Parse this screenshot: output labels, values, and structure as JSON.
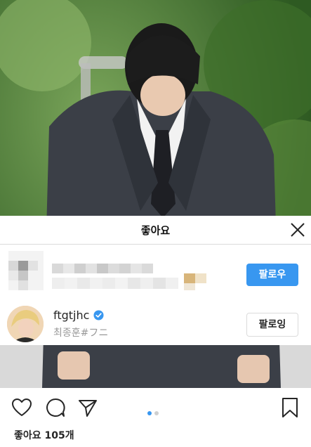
{
  "sheet": {
    "title": "좋아요",
    "rows": [
      {
        "follow_label": "팔로우"
      },
      {
        "username": "ftgtjhc",
        "subtitle": "최종훈#フニ",
        "follow_label": "팔로잉"
      }
    ]
  },
  "post": {
    "likes_text": "좋아요 105개",
    "carousel": {
      "current": 1,
      "total": 2
    }
  },
  "colors": {
    "accent": "#3897f0",
    "verified": "#3897f0"
  },
  "icons": [
    "close-icon",
    "heart-icon",
    "comment-icon",
    "share-icon",
    "bookmark-icon",
    "verified-icon"
  ]
}
